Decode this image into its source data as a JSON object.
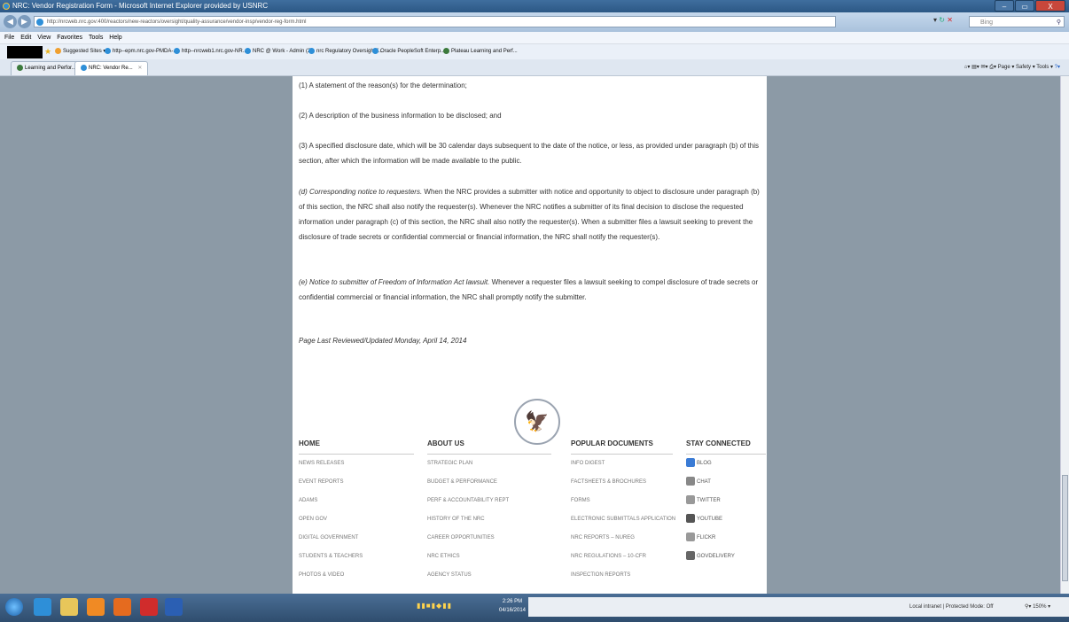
{
  "window": {
    "title": "NRC: Vendor Registration Form - Microsoft Internet Explorer provided by USNRC",
    "buttons": [
      "–",
      "▭",
      "X"
    ]
  },
  "address": {
    "url": "http://nrcweb.nrc.gov:400/reactors/new-reactors/oversight/quality-assurance/vendor-insp/vendor-reg-form.html",
    "search_placeholder": "Bing"
  },
  "menu": [
    "File",
    "Edit",
    "View",
    "Favorites",
    "Tools",
    "Help"
  ],
  "favorites": {
    "suggested": "Suggested Sites ▾",
    "items": [
      "http--epm.nrc.gov-PMDA-...",
      "http--nrcweb1.nrc.gov-NR...",
      "NRC @ Work - Admin (2)",
      "nrc Regulatory Oversight f...",
      "Oracle PeopleSoft Enterp...",
      "Plateau Learning and Perf..."
    ]
  },
  "tabs": [
    {
      "label": "Learning and Perfor..."
    },
    {
      "label": "NRC: Vendor Re..."
    }
  ],
  "commandbar": "Page ▾  Safety ▾  Tools ▾",
  "content": {
    "p1": "(1) A statement of the reason(s) for the determination;",
    "p2": "(2) A description of the business information to be disclosed; and",
    "p3": "(3) A specified disclosure date, which will be 30 calendar days subsequent to the date of the notice, or less, as provided under paragraph (b) of this section, after which the information will be made available to the public.",
    "p4_title": "(d) Corresponding notice to requesters.",
    "p4_body": "When the NRC provides a submitter with notice and opportunity to object to disclosure under paragraph (b) of this section, the NRC shall also notify the requester(s). Whenever the NRC notifies a submitter of its final decision to disclose the requested information under paragraph (c) of this section, the NRC shall also notify the requester(s). When a submitter files a lawsuit seeking to prevent the disclosure of trade secrets or confidential commercial or financial information, the NRC shall notify the requester(s).",
    "p5_title": "(e) Notice to submitter of Freedom of Information Act lawsuit.",
    "p5_body": "Whenever a requester files a lawsuit seeking to compel disclosure of trade secrets or confidential commercial or financial information, the NRC shall promptly notify the submitter.",
    "reviewed": "Page Last Reviewed/Updated Monday, April 14, 2014"
  },
  "footer": {
    "home": {
      "title": "HOME",
      "links": [
        "NEWS RELEASES",
        "EVENT REPORTS",
        "ADAMS",
        "OPEN GOV",
        "DIGITAL GOVERNMENT",
        "STUDENTS & TEACHERS",
        "PHOTOS & VIDEO"
      ]
    },
    "about": {
      "title": "ABOUT US",
      "links": [
        "STRATEGIC PLAN",
        "BUDGET & PERFORMANCE",
        "PERF & ACCOUNTABILITY REPT",
        "HISTORY OF THE NRC",
        "CAREER OPPORTUNITIES",
        "NRC ETHICS",
        "AGENCY STATUS"
      ]
    },
    "popular": {
      "title": "POPULAR DOCUMENTS",
      "links": [
        "INFO DIGEST",
        "FACTSHEETS & BROCHURES",
        "FORMS",
        "ELECTRONIC SUBMITTALS APPLICATION",
        "NRC REPORTS – NUREG",
        "NRC REGULATIONS – 10-CFR",
        "INSPECTION REPORTS"
      ]
    },
    "social": {
      "title": "STAY CONNECTED",
      "links": [
        "BLOG",
        "CHAT",
        "TWITTER",
        "YOUTUBE",
        "FLICKR",
        "GOVDELIVERY"
      ]
    }
  },
  "status": {
    "zone": "Local intranet | Protected Mode: Off",
    "zoom": "150%",
    "time": "2:26 PM",
    "date": "04/16/2014"
  },
  "colors": {
    "accent": "#2c5885",
    "blog": "#3a7bd5",
    "youtube": "#555555"
  }
}
